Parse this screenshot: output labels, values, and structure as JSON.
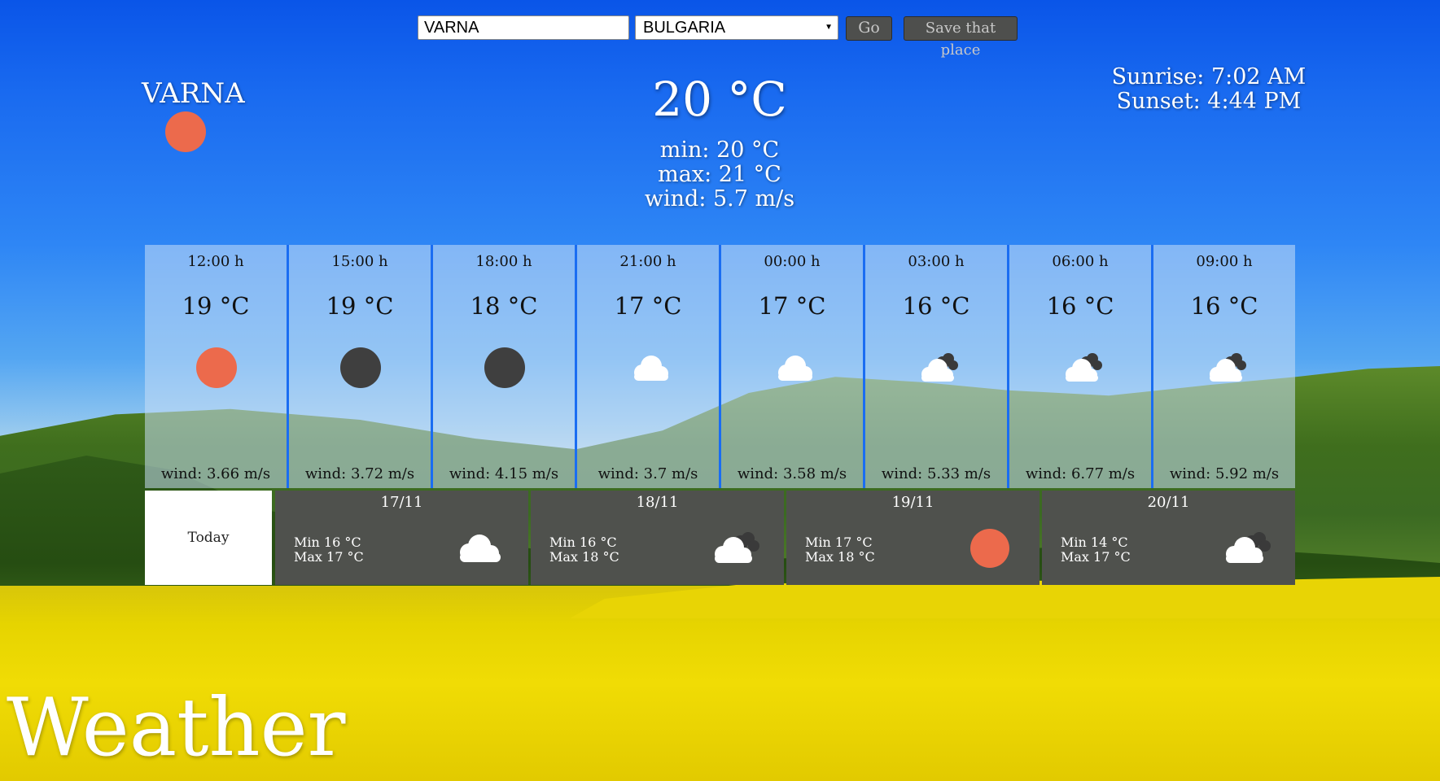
{
  "search": {
    "city_value": "VARNA",
    "country_selected": "BULGARIA",
    "go_label": "Go",
    "save_label": "Save that place"
  },
  "current": {
    "city": "VARNA",
    "temperature": "20 °C",
    "min": "min: 20 °C",
    "max": "max: 21 °C",
    "wind": "wind: 5.7 m/s",
    "sunrise": "Sunrise: 7:02 AM",
    "sunset": "Sunset: 4:44 PM",
    "icon": "sun-icon"
  },
  "hourly": [
    {
      "time": "12:00 h",
      "temp": "19 °C",
      "wind": "wind: 3.66 m/s",
      "icon": "sun-icon"
    },
    {
      "time": "15:00 h",
      "temp": "19 °C",
      "wind": "wind: 3.72 m/s",
      "icon": "moon-icon"
    },
    {
      "time": "18:00 h",
      "temp": "18 °C",
      "wind": "wind: 4.15 m/s",
      "icon": "moon-icon"
    },
    {
      "time": "21:00 h",
      "temp": "17 °C",
      "wind": "wind: 3.7 m/s",
      "icon": "cloud-icon"
    },
    {
      "time": "00:00 h",
      "temp": "17 °C",
      "wind": "wind: 3.58 m/s",
      "icon": "cloud-icon"
    },
    {
      "time": "03:00 h",
      "temp": "16 °C",
      "wind": "wind: 5.33 m/s",
      "icon": "clouds-icon"
    },
    {
      "time": "06:00 h",
      "temp": "16 °C",
      "wind": "wind: 6.77 m/s",
      "icon": "clouds-icon"
    },
    {
      "time": "09:00 h",
      "temp": "16 °C",
      "wind": "wind: 5.92 m/s",
      "icon": "clouds-icon"
    }
  ],
  "daily": {
    "today_label": "Today",
    "days": [
      {
        "date": "17/11",
        "min": "Min 16 °C",
        "max": "Max 17 °C",
        "icon": "cloud-icon"
      },
      {
        "date": "18/11",
        "min": "Min 16 °C",
        "max": "Max 18 °C",
        "icon": "clouds-icon"
      },
      {
        "date": "19/11",
        "min": "Min 17 °C",
        "max": "Max 18 °C",
        "icon": "sun-icon"
      },
      {
        "date": "20/11",
        "min": "Min 14 °C",
        "max": "Max 17 °C",
        "icon": "clouds-icon"
      }
    ]
  },
  "brand": "Weather",
  "colors": {
    "sun": "#ec6a4c",
    "moon": "#3f3f3f",
    "cloud": "#ffffff",
    "dark_cloud": "#3a3a3a",
    "day_card": "#4f514d",
    "sky": "#1a6bf0"
  }
}
